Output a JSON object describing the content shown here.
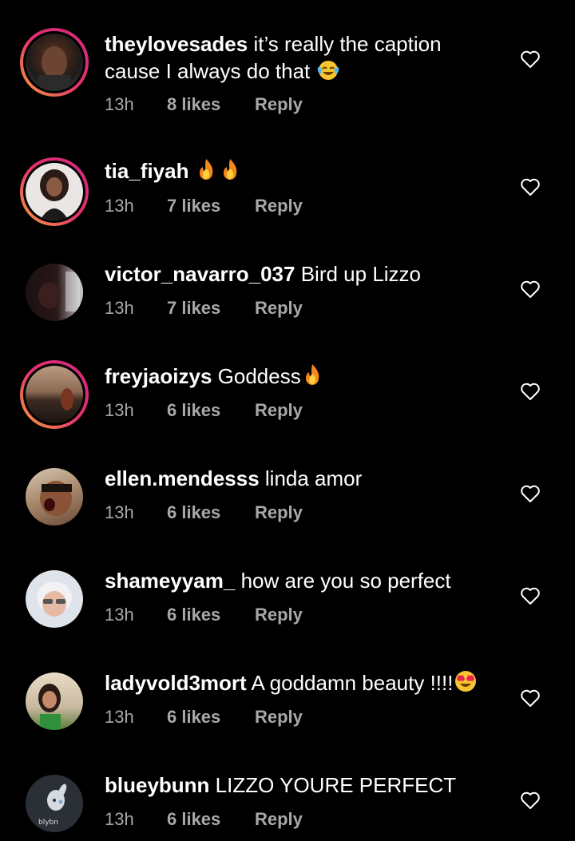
{
  "comments": [
    {
      "username": "theylovesades",
      "line1": "it’s really the caption",
      "line2": "cause I always do that",
      "emoji": "laughing-crying",
      "time": "13h",
      "likes": "8 likes",
      "reply": "Reply"
    },
    {
      "username": "tia_fiyah",
      "text": "",
      "emoji": "fire-fire",
      "time": "13h",
      "likes": "7 likes",
      "reply": "Reply"
    },
    {
      "username": "victor_navarro_037",
      "text": "Bird up Lizzo",
      "time": "13h",
      "likes": "7 likes",
      "reply": "Reply"
    },
    {
      "username": "freyjaoizys",
      "text": "Goddess",
      "emoji": "fire",
      "time": "13h",
      "likes": "6 likes",
      "reply": "Reply"
    },
    {
      "username": "ellen.mendesss",
      "text": "linda amor",
      "time": "13h",
      "likes": "6 likes",
      "reply": "Reply"
    },
    {
      "username": "shameyyam_",
      "text": "how are you so perfect",
      "time": "13h",
      "likes": "6 likes",
      "reply": "Reply"
    },
    {
      "username": "ladyvold3mort",
      "text": "A goddamn beauty !!!!",
      "emoji": "heart-eyes",
      "time": "13h",
      "likes": "6 likes",
      "reply": "Reply"
    },
    {
      "username": "blueybunn",
      "text": "LIZZO YOURE PERFECT",
      "time": "13h",
      "likes": "6 likes",
      "reply": "Reply",
      "avatar_caption": "blybn"
    }
  ]
}
